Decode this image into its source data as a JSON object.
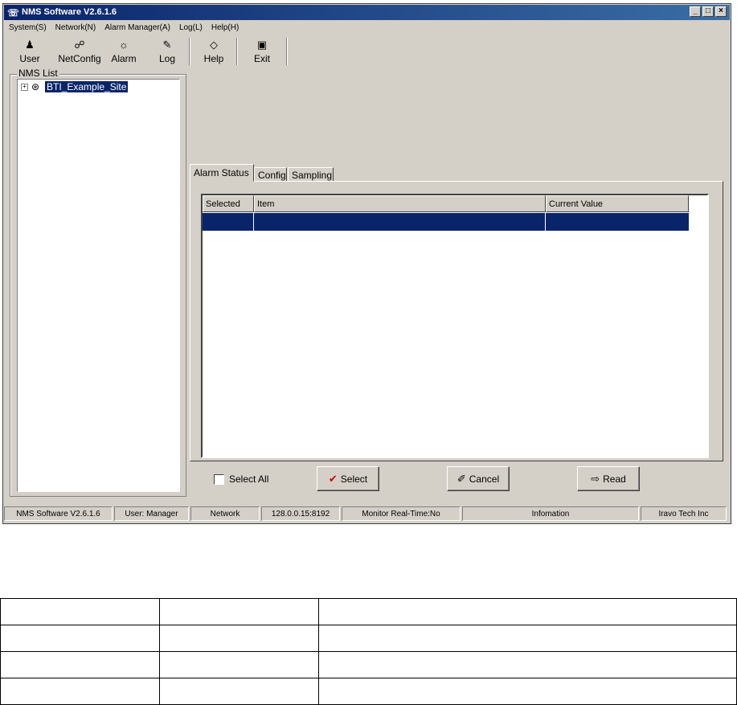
{
  "window": {
    "title": "NMS Software V2.6.1.6"
  },
  "menu": [
    "System(S)",
    "Network(N)",
    "Alarm Manager(A)",
    "Log(L)",
    "Help(H)"
  ],
  "toolbar": {
    "user": "User",
    "netconfig": "NetConfig",
    "alarm": "Alarm",
    "log": "Log",
    "help": "Help",
    "exit": "Exit"
  },
  "nms_list": {
    "label": "NMS List",
    "items": [
      {
        "label": "BTI_Example_Site",
        "selected": true
      }
    ]
  },
  "tabs": [
    "Alarm Status",
    "Config",
    "Sampling"
  ],
  "active_tab": "Alarm Status",
  "grid": {
    "columns": [
      "Selected",
      "Item",
      "Current Value"
    ],
    "rows": [
      [
        "",
        "",
        ""
      ]
    ]
  },
  "controls": {
    "select_all": "Select All",
    "select": "Select",
    "cancel": "Cancel",
    "read": "Read"
  },
  "status": {
    "app": "NMS Software V2.6.1.6",
    "user": "User: Manager",
    "network": "Network",
    "address": "128.0.0.15:8192",
    "monitor": "Monitor Real-Time:No",
    "info": "Infomation",
    "company": "Iravo Tech Inc"
  },
  "colors": {
    "selection": "#0a246a",
    "face": "#d4d0c8",
    "titlebar": "#0a246a"
  }
}
